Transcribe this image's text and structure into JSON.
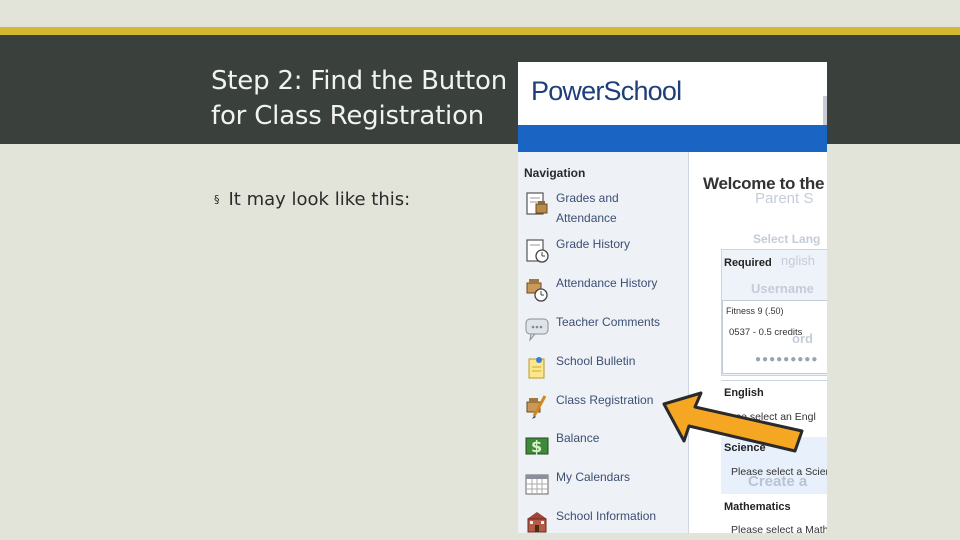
{
  "slide": {
    "title_line1": "Step 2: Find the Button",
    "title_line2": "for Class Registration",
    "bullet_mark": "§",
    "bullet": "It may look like this:"
  },
  "powerschool": {
    "logo": "PowerSchool",
    "nav_heading": "Navigation",
    "nav_items": [
      {
        "label": "Grades and",
        "label2": "Attendance",
        "icon": "grades-attendance-icon"
      },
      {
        "label": "Grade History",
        "icon": "grade-history-icon"
      },
      {
        "label": "Attendance History",
        "icon": "attendance-history-icon"
      },
      {
        "label": "Teacher Comments",
        "icon": "teacher-comments-icon"
      },
      {
        "label": "School Bulletin",
        "icon": "school-bulletin-icon"
      },
      {
        "label": "Class Registration",
        "icon": "class-registration-icon"
      },
      {
        "label": "Balance",
        "icon": "balance-icon"
      },
      {
        "label": "My Calendars",
        "icon": "my-calendars-icon"
      },
      {
        "label": "School Information",
        "icon": "school-information-icon"
      }
    ],
    "welcome": "Welcome to the",
    "ghost": {
      "parent": "Parent S",
      "select_lang": "Select Lang",
      "english": "nglish",
      "username": "Username",
      "password": "ord",
      "dots": "●●●●●●●●●",
      "create": "Create a"
    },
    "required": "Required",
    "fitness_title": "Fitness 9 (.50)",
    "fitness_sub": "0537 - 0.5 credits",
    "english_label": "English",
    "english_sub": "ase select an Engl",
    "science_label": "Science",
    "science_sub": "Please select a Scienc",
    "math_label": "Mathematics",
    "math_sub": "Please select a Math c"
  },
  "colors": {
    "banner": "#3a403c",
    "accent_line": "#d6b830",
    "ps_blue": "#1a64c4",
    "arrow": "#f5a623"
  }
}
